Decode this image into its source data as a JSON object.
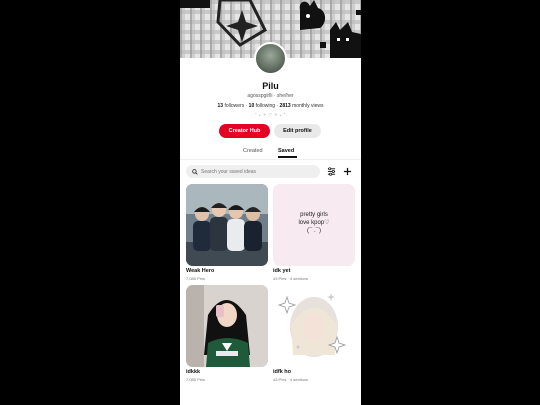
{
  "profile": {
    "name": "Pilu",
    "handle": "agosspgirlli · she/her",
    "followers_count": "13",
    "followers_label": "followers",
    "following_count": "10",
    "following_label": "following",
    "views_count": "2813",
    "views_label": "monthly views",
    "decoration": "˚ ₊ ✧ ♡ ✧ ₊ ˚"
  },
  "actions": {
    "creator_hub_label": "Creator Hub",
    "edit_profile_label": "Edit profile"
  },
  "tabs": [
    {
      "label": "Created",
      "active": false
    },
    {
      "label": "Saved",
      "active": true
    }
  ],
  "search": {
    "placeholder": "Search your saved ideas"
  },
  "icons": {
    "search": "search-icon",
    "filter": "filter-sliders-icon",
    "add": "plus-icon"
  },
  "boards": [
    {
      "title": "Weak Hero",
      "meta": "7,085 Pins"
    },
    {
      "title": "idk yet",
      "meta": "43 Pins · 4 sections",
      "cover_text_1": "pretty girls",
      "cover_text_2": "love kpop♡",
      "cover_text_3": "(¯ .¯)"
    },
    {
      "title": "idkkk",
      "meta": "7,085 Pins"
    },
    {
      "title": "idfk ho",
      "meta": "43 Pins · 4 sections"
    }
  ],
  "colors": {
    "accent": "#e60023",
    "pink_board": "#f7eaf0"
  }
}
